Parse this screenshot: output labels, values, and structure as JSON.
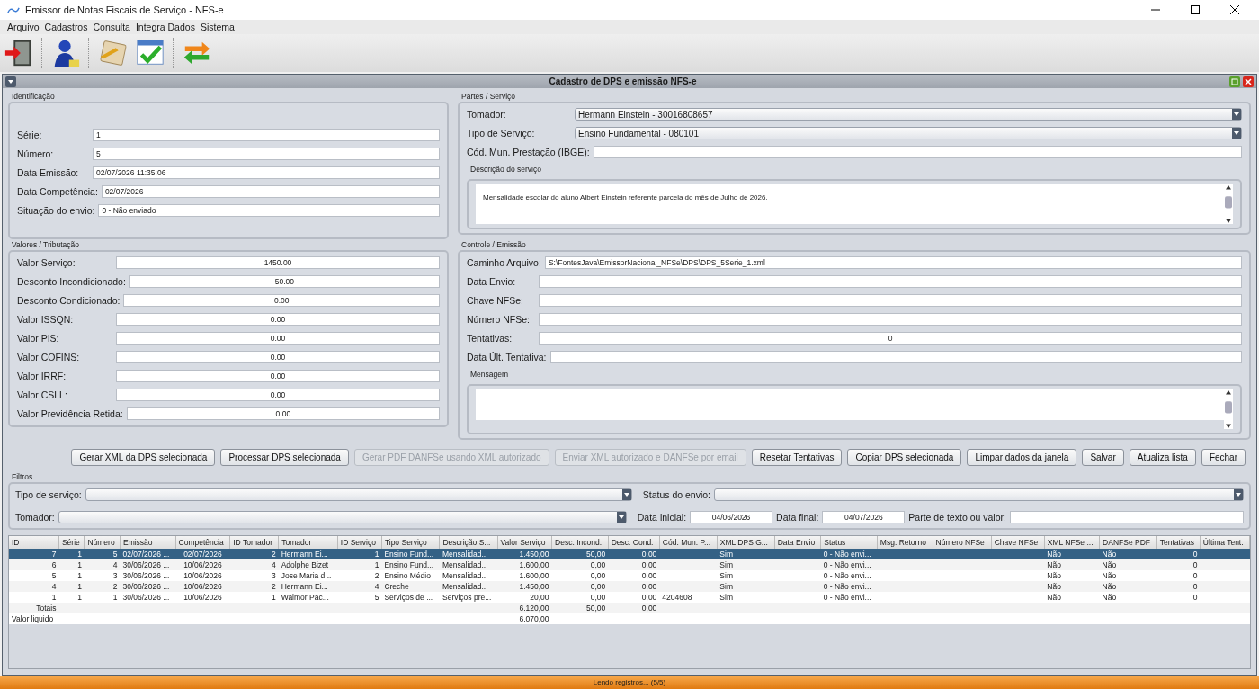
{
  "window": {
    "title": "Emissor de Notas Fiscais de Serviço - NFS-e"
  },
  "menu": [
    "Arquivo",
    "Cadastros",
    "Consulta",
    "Integra Dados",
    "Sistema"
  ],
  "frame": {
    "title": "Cadastro de DPS e emissão NFS-e"
  },
  "identificacao": {
    "title": "Identificação",
    "fields": [
      {
        "label": "Série:",
        "value": "1"
      },
      {
        "label": "Número:",
        "value": "5"
      },
      {
        "label": "Data Emissão:",
        "value": "02/07/2026 11:35:06"
      },
      {
        "label": "Data Competência:",
        "value": "02/07/2026"
      },
      {
        "label": "Situação do envio:",
        "value": "0 - Não enviado"
      }
    ]
  },
  "partes": {
    "title": "Partes / Serviço",
    "fields": [
      {
        "label": "Tomador:",
        "value": "Hermann Einstein - 30016808657",
        "kind": "select"
      },
      {
        "label": "Tipo de Serviço:",
        "value": "Ensino Fundamental - 080101",
        "kind": "select"
      },
      {
        "label": "Cód. Mun. Prestação (IBGE):",
        "kind": "text"
      }
    ],
    "descricao": {
      "title": "Descrição do serviço",
      "value": "Mensalidade escolar do aluno Albert Einstein referente parcela do mês de Julho de 2026."
    }
  },
  "valores": {
    "title": "Valores / Tributação",
    "fields": [
      {
        "label": "Valor Serviço:",
        "value": "1450.00"
      },
      {
        "label": "Desconto Incondicionado:",
        "value": "50.00"
      },
      {
        "label": "Desconto Condicionado:",
        "value": "0.00"
      },
      {
        "label": "Valor ISSQN:",
        "value": "0.00"
      },
      {
        "label": "Valor PIS:",
        "value": "0.00"
      },
      {
        "label": "Valor COFINS:",
        "value": "0.00"
      },
      {
        "label": "Valor IRRF:",
        "value": "0.00"
      },
      {
        "label": "Valor CSLL:",
        "value": "0.00"
      },
      {
        "label": "Valor Previdência Retida:",
        "value": "0.00"
      }
    ]
  },
  "controle": {
    "title": "Controle / Emissão",
    "fields": [
      {
        "label": "Caminho Arquivo:",
        "value": "S:\\FontesJava\\EmissorNacional_NFSe\\DPS\\DPS_5Serie_1.xml",
        "kind": "text"
      },
      {
        "label": "Data Envio:",
        "kind": "text"
      },
      {
        "label": "Chave NFSe:",
        "kind": "text"
      },
      {
        "label": "Número NFSe:",
        "kind": "text"
      },
      {
        "label": "Tentativas:",
        "value": "0",
        "kind": "number"
      },
      {
        "label": "Data Últ. Tentativa:",
        "kind": "text"
      }
    ],
    "mensagem": {
      "title": "Mensagem"
    }
  },
  "buttons": [
    {
      "label": "Gerar XML da DPS selecionada",
      "disabled": false
    },
    {
      "label": "Processar DPS selecionada",
      "disabled": false
    },
    {
      "label": "Gerar PDF DANFSe usando XML autorizado",
      "disabled": true
    },
    {
      "label": "Enviar XML autorizado e DANFSe por email",
      "disabled": true
    },
    {
      "label": "Resetar Tentativas",
      "disabled": false
    },
    {
      "label": "Copiar DPS selecionada",
      "disabled": false
    },
    {
      "label": "Limpar dados da janela",
      "disabled": false
    },
    {
      "label": "Salvar",
      "disabled": false
    },
    {
      "label": "Atualiza lista",
      "disabled": false
    },
    {
      "label": "Fechar",
      "disabled": false
    }
  ],
  "filtros": {
    "title": "Filtros",
    "tipo_servico": {
      "label": "Tipo de serviço:"
    },
    "status_envio": {
      "label": "Status do envio:"
    },
    "tomador": {
      "label": "Tomador:"
    },
    "data_inicial": {
      "label": "Data inicial:",
      "value": "04/06/2026"
    },
    "data_final": {
      "label": "Data final:",
      "value": "04/07/2026"
    },
    "texto": {
      "label": "Parte de texto ou valor:"
    }
  },
  "table": {
    "columns": [
      "ID",
      "Série",
      "Número",
      "Emissão",
      "Competência",
      "ID Tomador",
      "Tomador",
      "ID Serviço",
      "Tipo Serviço",
      "Descrição S...",
      "Valor Serviço",
      "Desc. Incond.",
      "Desc. Cond.",
      "Cód. Mun. P...",
      "XML DPS G...",
      "Data Envio",
      "Status",
      "Msg. Retorno",
      "Número NFSe",
      "Chave NFSe",
      "XML NFSe ...",
      "DANFSe PDF",
      "Tentativas",
      "Última Tent."
    ],
    "rows": [
      {
        "selected": true,
        "cells": [
          "7",
          "1",
          "5",
          "02/07/2026 ...",
          "02/07/2026",
          "2",
          "Hermann Ei...",
          "1",
          "Ensino Fund...",
          "Mensalidad...",
          "1.450,00",
          "50,00",
          "0,00",
          null,
          "Sim",
          null,
          "0 - Não envi...",
          null,
          null,
          null,
          "Não",
          "Não",
          "0",
          null
        ]
      },
      {
        "selected": false,
        "cells": [
          "6",
          "1",
          "4",
          "30/06/2026 ...",
          "10/06/2026",
          "4",
          "Adolphe Bizet",
          "1",
          "Ensino Fund...",
          "Mensalidad...",
          "1.600,00",
          "0,00",
          "0,00",
          null,
          "Sim",
          null,
          "0 - Não envi...",
          null,
          null,
          null,
          "Não",
          "Não",
          "0",
          null
        ]
      },
      {
        "selected": false,
        "cells": [
          "5",
          "1",
          "3",
          "30/06/2026 ...",
          "10/06/2026",
          "3",
          "Jose Maria d...",
          "2",
          "Ensino Médio",
          "Mensalidad...",
          "1.600,00",
          "0,00",
          "0,00",
          null,
          "Sim",
          null,
          "0 - Não envi...",
          null,
          null,
          null,
          "Não",
          "Não",
          "0",
          null
        ]
      },
      {
        "selected": false,
        "cells": [
          "4",
          "1",
          "2",
          "30/06/2026 ...",
          "10/06/2026",
          "2",
          "Hermann Ei...",
          "4",
          "Creche",
          "Mensalidad...",
          "1.450,00",
          "0,00",
          "0,00",
          null,
          "Sim",
          null,
          "0 - Não envi...",
          null,
          null,
          null,
          "Não",
          "Não",
          "0",
          null
        ]
      },
      {
        "selected": false,
        "cells": [
          "1",
          "1",
          "1",
          "30/06/2026 ...",
          "10/06/2026",
          "1",
          "Walmor Pac...",
          "5",
          "Serviços de ...",
          "Serviços pre...",
          "20,00",
          "0,00",
          "0,00",
          "4204608",
          "Sim",
          null,
          "0 - Não envi...",
          null,
          null,
          null,
          "Não",
          "Não",
          "0",
          null
        ]
      }
    ],
    "summary": [
      {
        "kind": "total",
        "cells": [
          "Totais",
          null,
          null,
          null,
          null,
          null,
          null,
          null,
          null,
          null,
          "6.120,00",
          "50,00",
          "0,00"
        ]
      },
      {
        "kind": "net",
        "cells": [
          "Valor liquido",
          null,
          null,
          null,
          null,
          null,
          null,
          null,
          null,
          null,
          "6.070,00"
        ]
      }
    ]
  },
  "status_bar": {
    "text": "Lendo registros... (5/5)",
    "level": 1
  }
}
